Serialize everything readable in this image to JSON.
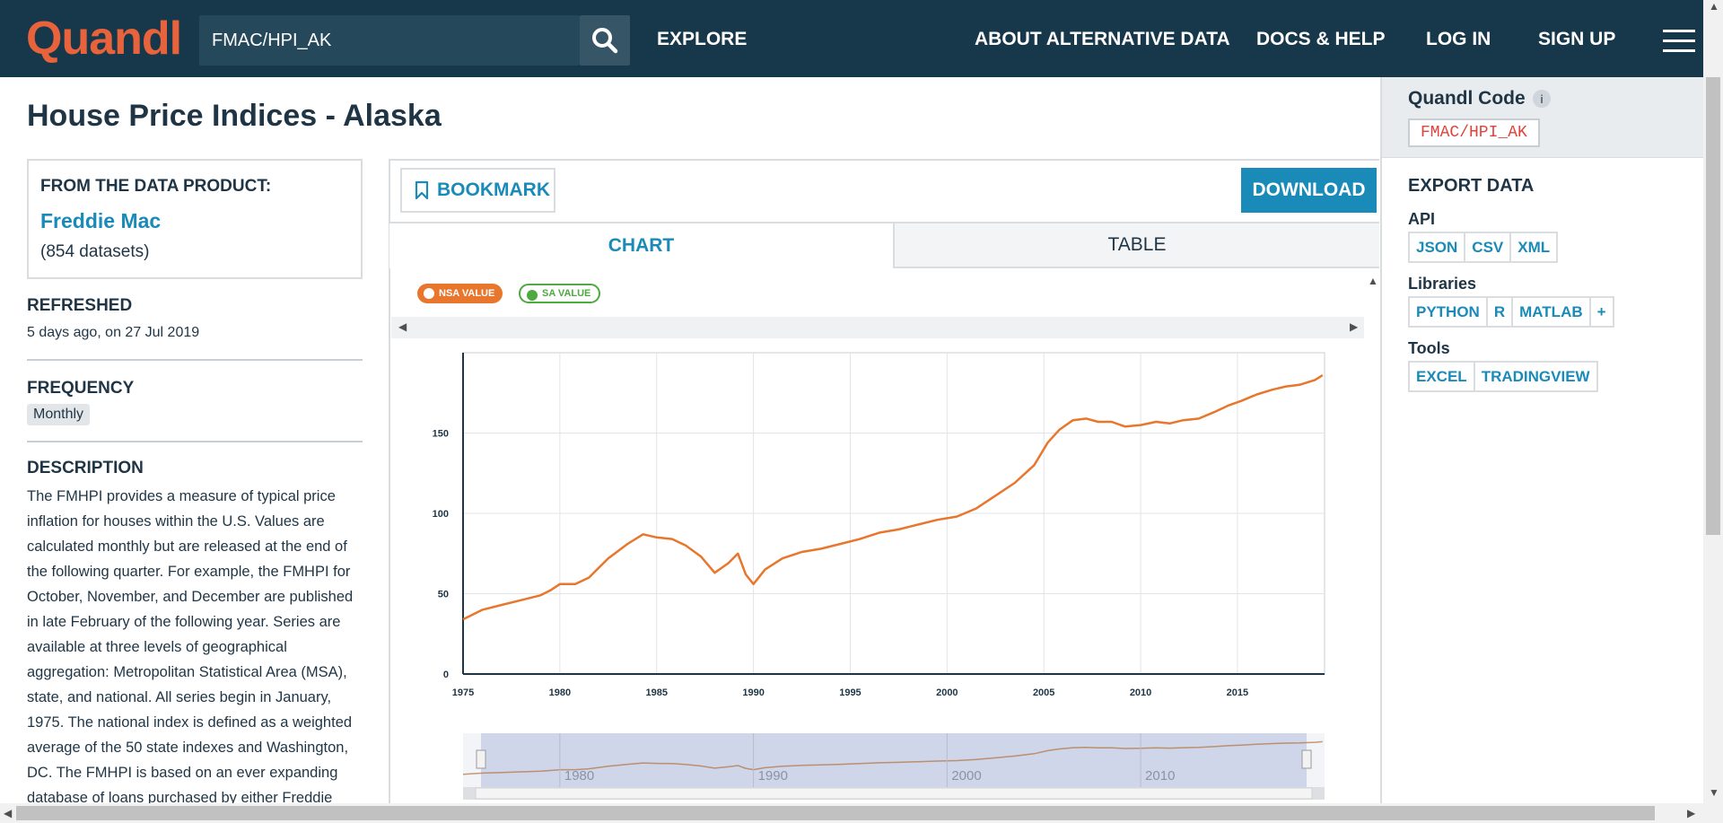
{
  "header": {
    "logo": "Quandl",
    "search_value": "FMAC/HPI_AK",
    "nav": {
      "explore": "EXPLORE",
      "about": "ABOUT ALTERNATIVE DATA",
      "docs": "DOCS & HELP",
      "login": "LOG IN",
      "signup": "SIGN UP"
    }
  },
  "page": {
    "title": "House Price Indices - Alaska"
  },
  "sidebar": {
    "product_heading": "FROM THE DATA PRODUCT:",
    "product_name": "Freddie Mac",
    "product_count": "(854 datasets)",
    "refreshed_title": "REFRESHED",
    "refreshed_value": "5 days ago, on 27 Jul 2019",
    "frequency_title": "FREQUENCY",
    "frequency_value": "Monthly",
    "description_title": "DESCRIPTION",
    "description": "The FMHPI provides a measure of typical price inflation for houses within the U.S. Values are calculated monthly but are released at the end of the following quarter. For example, the FMHPI for October, November, and December are published in late February of the following year. Series are available at three levels of geographical aggregation: Metropolitan Statistical Area (MSA), state, and national. All series begin in January, 1975. The national index is defined as a weighted average of the 50 state indexes and Washington, DC. The FMHPI is based on an ever expanding database of loans purchased by either Freddie"
  },
  "toolbar": {
    "bookmark": "BOOKMARK",
    "download": "DOWNLOAD"
  },
  "tabs": {
    "chart": "CHART",
    "table": "TABLE"
  },
  "legend": {
    "nsa": "NSA VALUE",
    "sa": "SA VALUE",
    "nsa_color": "#e8762d",
    "sa_color": "#4caa3e"
  },
  "chart_data": {
    "type": "line",
    "title": "",
    "xlabel": "",
    "ylabel": "",
    "xlim": [
      1975,
      2019.5
    ],
    "ylim": [
      0,
      200
    ],
    "yticks": [
      0,
      50,
      100,
      150
    ],
    "xticks": [
      1975,
      1980,
      1985,
      1990,
      1995,
      2000,
      2005,
      2010,
      2015
    ],
    "grid": true,
    "series": [
      {
        "name": "NSA VALUE",
        "color": "#e8762d",
        "x": [
          1975,
          1976,
          1977,
          1978,
          1979,
          1979.5,
          1980,
          1980.8,
          1981.5,
          1982.5,
          1983.5,
          1984.3,
          1985,
          1985.8,
          1986.5,
          1987.3,
          1988,
          1988.7,
          1989.2,
          1989.6,
          1990,
          1990.6,
          1991.5,
          1992.5,
          1993.5,
          1994.5,
          1995.5,
          1996.5,
          1997.5,
          1998.5,
          1999.5,
          2000.5,
          2001.5,
          2002.5,
          2003.5,
          2004.5,
          2005.2,
          2005.8,
          2006.5,
          2007.2,
          2007.8,
          2008.5,
          2009.2,
          2010,
          2010.8,
          2011.5,
          2012.2,
          2013,
          2013.8,
          2014.5,
          2015.2,
          2016,
          2016.8,
          2017.5,
          2018.2,
          2019,
          2019.4
        ],
        "y": [
          34,
          40,
          43,
          46,
          49,
          52,
          56,
          56,
          60,
          72,
          81,
          87,
          85,
          84,
          80,
          73,
          63,
          69,
          75,
          62,
          56,
          65,
          72,
          76,
          78,
          81,
          84,
          88,
          90,
          93,
          96,
          98,
          103,
          111,
          119,
          130,
          144,
          152,
          158,
          159,
          157,
          157,
          154,
          155,
          157,
          156,
          158,
          159,
          163,
          167,
          170,
          174,
          177,
          179,
          180,
          183,
          186
        ]
      }
    ]
  },
  "navigator": {
    "labels": [
      "1980",
      "1990",
      "2000",
      "2010"
    ]
  },
  "export": {
    "code_label": "Quandl Code",
    "code_value": "FMAC/HPI_AK",
    "title": "EXPORT DATA",
    "api_label": "API",
    "api_buttons": [
      "JSON",
      "CSV",
      "XML"
    ],
    "libraries_label": "Libraries",
    "library_buttons": [
      "PYTHON",
      "R",
      "MATLAB",
      "+"
    ],
    "tools_label": "Tools",
    "tool_buttons": [
      "EXCEL",
      "TRADINGVIEW"
    ]
  }
}
